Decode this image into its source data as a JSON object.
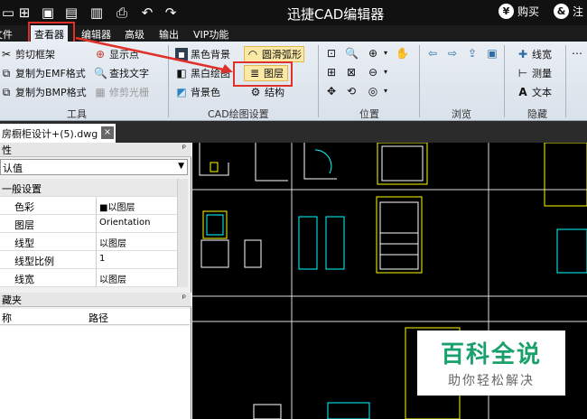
{
  "titlebar": {
    "app_title": "迅捷CAD编辑器",
    "buy_label": "购买",
    "register_label": "注",
    "buy_icon_glyph": "¥",
    "register_icon_glyph": "&"
  },
  "menubar": {
    "items": [
      "文件",
      "查看器",
      "编辑器",
      "高级",
      "输出",
      "VIP功能"
    ],
    "active": "查看器"
  },
  "ribbon": {
    "tools": {
      "items": [
        "剪切框架",
        "复制为EMF格式",
        "复制为BMP格式",
        "显示点",
        "查找文字",
        "修剪光栅"
      ],
      "group_label": "工具"
    },
    "cad_settings": {
      "items": [
        "黑色背景",
        "圆滑弧形",
        "黑白绘图",
        "图层",
        "背景色",
        "结构"
      ],
      "group_label": "CAD绘图设置"
    },
    "position": {
      "group_label": "位置"
    },
    "browse": {
      "group_label": "浏览"
    },
    "hidden": {
      "items": [
        "线宽",
        "测量",
        "文本"
      ],
      "group_label": "隐藏"
    }
  },
  "document": {
    "tab_label": "房橱柜设计+(5).dwg",
    "close_glyph": "×"
  },
  "properties": {
    "header": "性",
    "pin_glyph": "ᵖ",
    "selector_value": "认值",
    "section": "一般设置",
    "rows": [
      {
        "key": "色彩",
        "value": "■以图层"
      },
      {
        "key": "图层",
        "value": "Orientation"
      },
      {
        "key": "线型",
        "value": "以图层"
      },
      {
        "key": "线型比例",
        "value": "1"
      },
      {
        "key": "线宽",
        "value": "以图层"
      }
    ]
  },
  "bookmarks": {
    "header": "藏夹",
    "pin_glyph": "ᵖ",
    "columns": [
      "称",
      "路径"
    ]
  },
  "watermark": {
    "title": "百科全说",
    "subtitle": "助你轻松解决"
  }
}
